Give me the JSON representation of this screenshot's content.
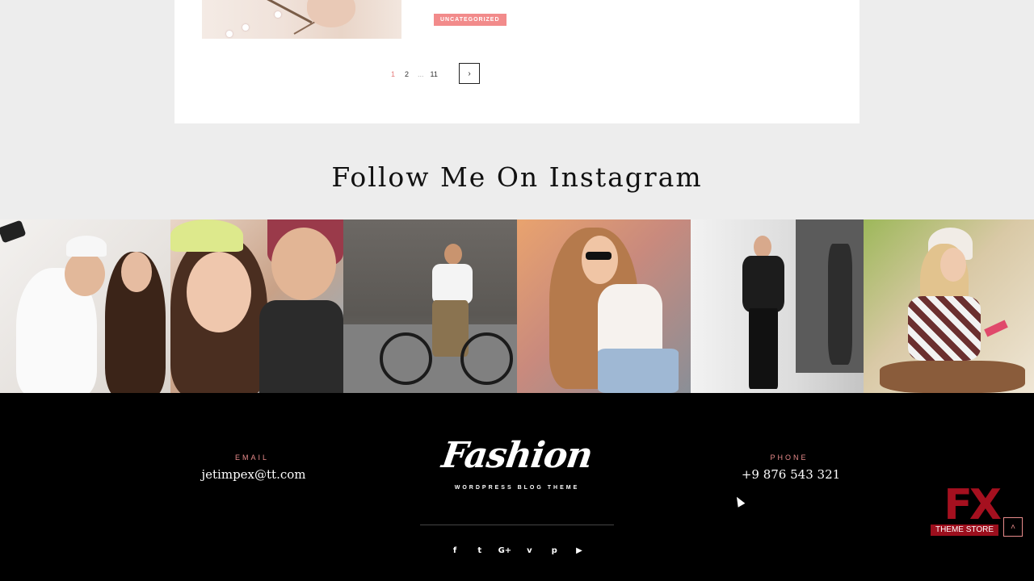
{
  "post": {
    "category": "UNCATEGORIZED"
  },
  "pagination": {
    "pages": [
      "1",
      "2",
      "...",
      "11"
    ],
    "current": "1",
    "next_icon": "chevron-right-icon",
    "next_glyph": "›"
  },
  "instagram": {
    "title": "Follow Me On Instagram",
    "photos": [
      {
        "name": "instagram-photo-friends-selfie"
      },
      {
        "name": "instagram-photo-couple-smiling"
      },
      {
        "name": "instagram-photo-man-bicycle"
      },
      {
        "name": "instagram-photo-woman-sunglasses"
      },
      {
        "name": "instagram-photo-man-leather-jacket"
      },
      {
        "name": "instagram-photo-woman-tablet"
      }
    ]
  },
  "footer": {
    "email_label": "EMAIL",
    "email": "jetimpex@tt.com",
    "logo": "Fashion",
    "tagline": "WORDPRESS BLOG THEME",
    "phone_label": "PHONE",
    "phone": "+9 876 543 321",
    "social": [
      {
        "icon": "facebook-icon",
        "glyph": "f"
      },
      {
        "icon": "twitter-icon",
        "glyph": "t"
      },
      {
        "icon": "google-plus-icon",
        "glyph": "G+"
      },
      {
        "icon": "vimeo-icon",
        "glyph": "v"
      },
      {
        "icon": "pinterest-icon",
        "glyph": "p"
      },
      {
        "icon": "youtube-icon",
        "glyph": "▶"
      }
    ],
    "back_to_top_glyph": "˄"
  },
  "watermark": {
    "letters": "FX",
    "text": "THEME STORE"
  },
  "colors": {
    "accent": "#f28b8b",
    "footer_bg": "#000000",
    "page_bg": "#ededed"
  }
}
